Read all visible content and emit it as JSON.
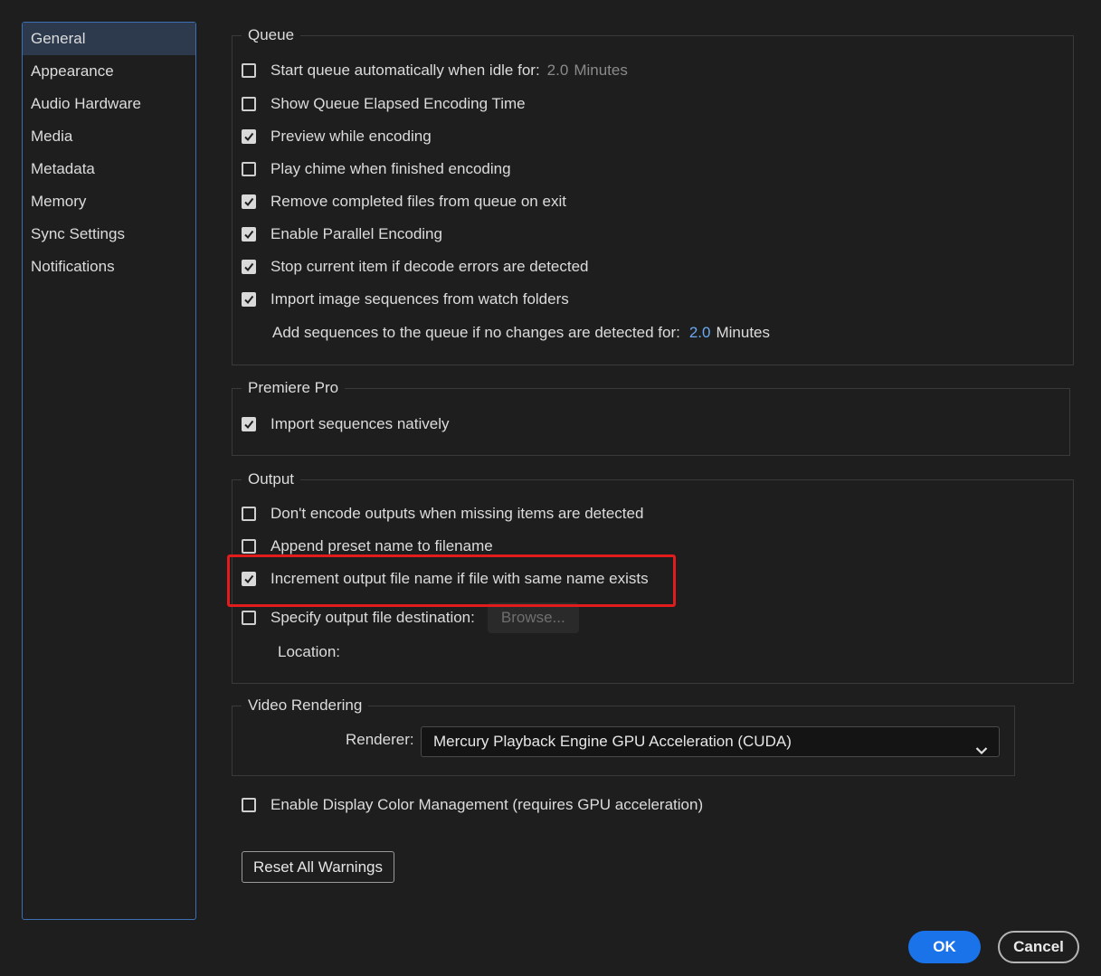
{
  "sidebar": {
    "items": [
      {
        "label": "General"
      },
      {
        "label": "Appearance"
      },
      {
        "label": "Audio Hardware"
      },
      {
        "label": "Media"
      },
      {
        "label": "Metadata"
      },
      {
        "label": "Memory"
      },
      {
        "label": "Sync Settings"
      },
      {
        "label": "Notifications"
      }
    ],
    "selected": "General"
  },
  "queue": {
    "legend": "Queue",
    "start_idle": {
      "label": "Start queue automatically when idle for:",
      "value": "2.0",
      "unit": "Minutes",
      "checked": false
    },
    "show_elapsed": {
      "label": "Show Queue Elapsed Encoding Time",
      "checked": false
    },
    "preview": {
      "label": "Preview while encoding",
      "checked": true
    },
    "chime": {
      "label": "Play chime when finished encoding",
      "checked": false
    },
    "remove_completed": {
      "label": "Remove completed files from queue on exit",
      "checked": true
    },
    "parallel": {
      "label": "Enable Parallel Encoding",
      "checked": true
    },
    "stop_decode": {
      "label": "Stop current item if decode errors are detected",
      "checked": true
    },
    "import_watch": {
      "label": "Import image sequences from watch folders",
      "checked": true
    },
    "add_sequences": {
      "label": "Add sequences to the queue if no changes are detected for:",
      "value": "2.0",
      "unit": "Minutes"
    }
  },
  "premiere": {
    "legend": "Premiere Pro",
    "import_native": {
      "label": "Import sequences natively",
      "checked": true
    }
  },
  "output": {
    "legend": "Output",
    "dont_encode": {
      "label": "Don't encode outputs when missing items are detected",
      "checked": false
    },
    "append_preset": {
      "label": "Append preset name to filename",
      "checked": false
    },
    "increment": {
      "label": "Increment output file name if file with same name exists",
      "checked": true
    },
    "specify_dest": {
      "label": "Specify output file destination:",
      "checked": false,
      "browse": "Browse..."
    },
    "location_label": "Location:"
  },
  "video": {
    "legend": "Video Rendering",
    "renderer_label": "Renderer:",
    "renderer_value": "Mercury Playback Engine GPU Acceleration (CUDA)"
  },
  "color_mgmt": {
    "label": "Enable Display Color Management (requires GPU acceleration)",
    "checked": false
  },
  "buttons": {
    "reset": "Reset All Warnings",
    "ok": "OK",
    "cancel": "Cancel"
  },
  "colors": {
    "accent": "#1a73e8",
    "highlight": "#e21c1c",
    "selected_bg": "#2d3a4e"
  }
}
